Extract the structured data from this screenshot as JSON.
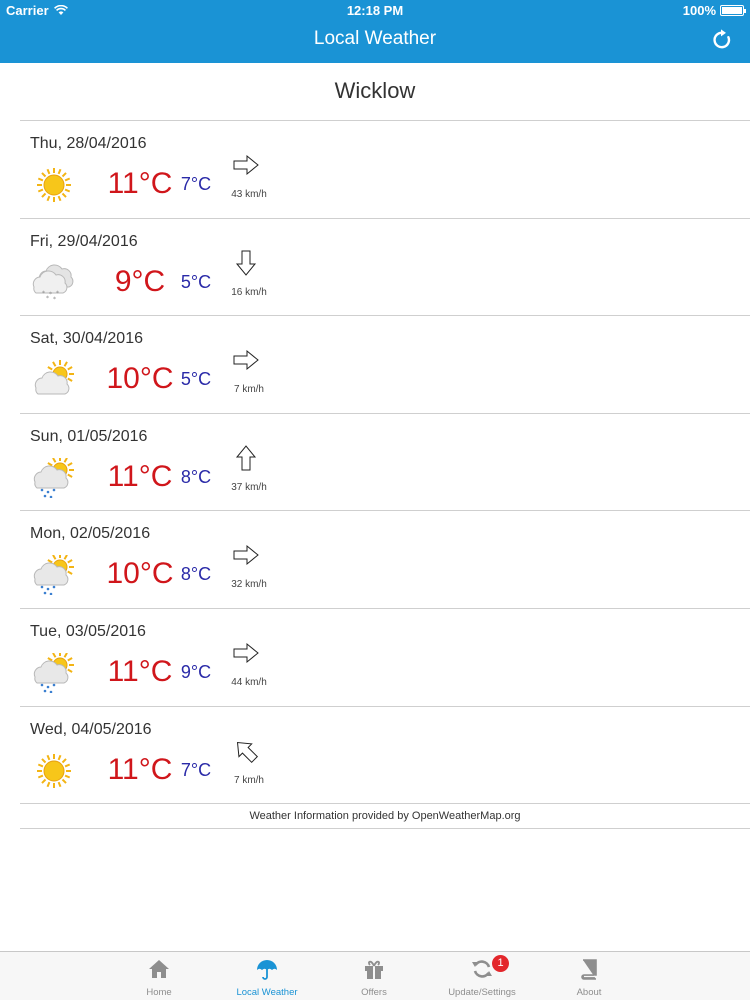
{
  "status": {
    "carrier": "Carrier",
    "time": "12:18 PM",
    "battery": "100%"
  },
  "nav": {
    "title": "Local Weather",
    "refresh_icon": "refresh-icon"
  },
  "location": "Wicklow",
  "forecast": [
    {
      "date": "Thu, 28/04/2016",
      "icon": "sunny",
      "high": "11°C",
      "low": "7°C",
      "wind_dir": "right",
      "wind": "43 km/h"
    },
    {
      "date": "Fri, 29/04/2016",
      "icon": "snow-cloud",
      "high": "9°C",
      "low": "5°C",
      "wind_dir": "down",
      "wind": "16 km/h"
    },
    {
      "date": "Sat, 30/04/2016",
      "icon": "cloud-sun",
      "high": "10°C",
      "low": "5°C",
      "wind_dir": "right",
      "wind": "7 km/h"
    },
    {
      "date": "Sun, 01/05/2016",
      "icon": "rain-sun",
      "high": "11°C",
      "low": "8°C",
      "wind_dir": "up",
      "wind": "37 km/h"
    },
    {
      "date": "Mon, 02/05/2016",
      "icon": "rain-sun",
      "high": "10°C",
      "low": "8°C",
      "wind_dir": "right",
      "wind": "32 km/h"
    },
    {
      "date": "Tue, 03/05/2016",
      "icon": "rain-sun",
      "high": "11°C",
      "low": "9°C",
      "wind_dir": "right",
      "wind": "44 km/h"
    },
    {
      "date": "Wed, 04/05/2016",
      "icon": "sunny",
      "high": "11°C",
      "low": "7°C",
      "wind_dir": "up-left",
      "wind": "7 km/h"
    }
  ],
  "credit": "Weather Information provided by OpenWeatherMap.org",
  "tabs": [
    {
      "label": "Home",
      "icon": "home-icon",
      "active": false
    },
    {
      "label": "Local Weather",
      "icon": "umbrella-icon",
      "active": true
    },
    {
      "label": "Offers",
      "icon": "gift-icon",
      "active": false
    },
    {
      "label": "Update/Settings",
      "icon": "sync-icon",
      "active": false,
      "badge": "1"
    },
    {
      "label": "About",
      "icon": "book-icon",
      "active": false
    }
  ],
  "colors": {
    "nav": "#1a93d5",
    "high_temp": "#d0161b",
    "low_temp": "#2a2aa8",
    "badge": "#e3262b"
  }
}
